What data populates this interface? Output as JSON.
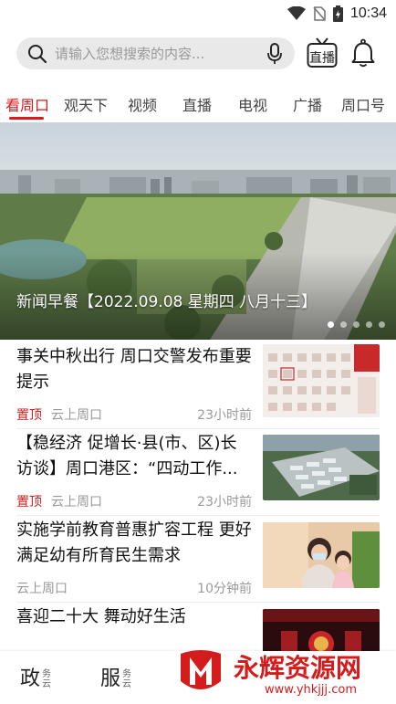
{
  "status_bar": {
    "time": "10:34"
  },
  "search": {
    "placeholder": "请输入您想搜索的内容..."
  },
  "header": {
    "live_label": "直播"
  },
  "tabs": [
    {
      "label": "看周口",
      "active": true
    },
    {
      "label": "观天下"
    },
    {
      "label": "视频"
    },
    {
      "label": "直播"
    },
    {
      "label": "电视"
    },
    {
      "label": "广播"
    },
    {
      "label": "周口号"
    }
  ],
  "banner": {
    "caption": "新闻早餐【2022.09.08 星期四 八月十三】",
    "slide_count": 5,
    "active_index": 0
  },
  "news": [
    {
      "title": "事关中秋出行 周口交警发布重要提示",
      "pinned_label": "置顶",
      "source": "云上周口",
      "time": "23小时前"
    },
    {
      "title": "【稳经济 促增长·县(市、区)长访谈】周口港区：“四动工作...",
      "pinned_label": "置顶",
      "source": "云上周口",
      "time": "23小时前"
    },
    {
      "title": "实施学前教育普惠扩容工程 更好满足幼有所育民生需求",
      "pinned_label": "",
      "source": "云上周口",
      "time": "10分钟前"
    },
    {
      "title": "喜迎二十大 舞动好生活"
    }
  ],
  "bottom_nav": [
    {
      "main": "政",
      "sub": "务云"
    },
    {
      "main": "服",
      "sub": "务云"
    }
  ],
  "watermark": {
    "text": "永辉资源网",
    "url": "www.yhkjjj.com"
  },
  "colors": {
    "accent": "#d71a1b"
  }
}
